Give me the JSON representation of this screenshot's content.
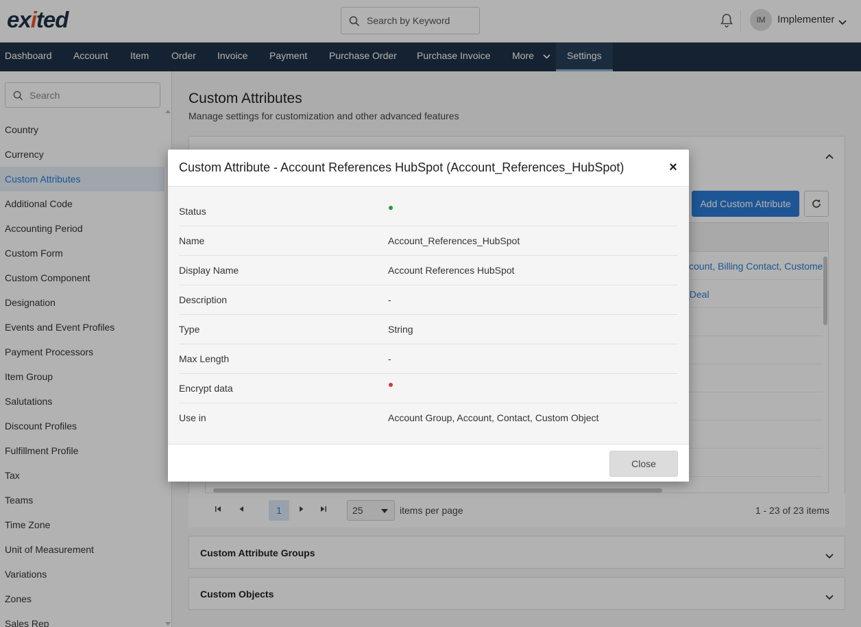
{
  "header": {
    "logo_part1": "ex",
    "logo_accent": "i",
    "logo_part2": "ted",
    "search_placeholder": "Search by Keyword",
    "avatar_initials": "IM",
    "user_name": "Implementer"
  },
  "nav": {
    "items": [
      "Dashboard",
      "Account",
      "Item",
      "Order",
      "Invoice",
      "Payment",
      "Purchase Order",
      "Purchase Invoice",
      "More",
      "Settings"
    ],
    "active": "Settings"
  },
  "sidebar": {
    "search_placeholder": "Search",
    "items": [
      "Country",
      "Currency",
      "Custom Attributes",
      "Additional Code",
      "Accounting Period",
      "Custom Form",
      "Custom Component",
      "Designation",
      "Events and Event Profiles",
      "Payment Processors",
      "Item Group",
      "Salutations",
      "Discount Profiles",
      "Fulfillment Profile",
      "Tax",
      "Teams",
      "Time Zone",
      "Unit of Measurement",
      "Variations",
      "Zones",
      "Sales Rep"
    ],
    "active": "Custom Attributes"
  },
  "main": {
    "title": "Custom Attributes",
    "subtitle": "Manage settings for customization and other advanced features",
    "add_button": "Add Custom Attribute",
    "grid_row1_text": "ccount, Billing Contact, Custome",
    "grid_row2_text": "_Deal",
    "pager": {
      "page": "1",
      "page_size": "25",
      "items_per_page_label": "items per page",
      "count_label": "1 - 23 of 23 items"
    },
    "panels": {
      "groups": "Custom Attribute Groups",
      "objects": "Custom Objects"
    }
  },
  "modal": {
    "title": "Custom Attribute - Account References HubSpot (Account_References_HubSpot)",
    "close_label": "Close",
    "status_active_color": "#1e9e3e",
    "encrypt_color": "#d13a3a",
    "rows": {
      "status_label": "Status",
      "name_label": "Name",
      "name_value": "Account_References_HubSpot",
      "display_name_label": "Display Name",
      "display_name_value": "Account References HubSpot",
      "description_label": "Description",
      "description_value": "-",
      "type_label": "Type",
      "type_value": "String",
      "max_length_label": "Max Length",
      "max_length_value": "-",
      "encrypt_label": "Encrypt data",
      "use_in_label": "Use in",
      "use_in_value": "Account Group, Account, Contact, Custom Object"
    }
  }
}
